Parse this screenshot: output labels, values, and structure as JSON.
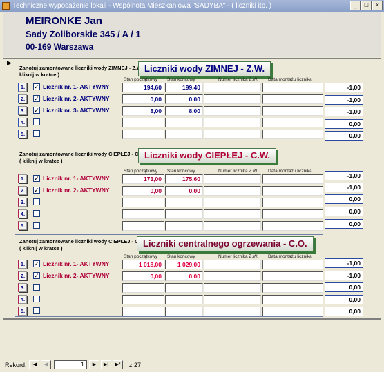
{
  "window": {
    "title": "Techniczne wyposażenie lokali - Wspólnota Mieszkaniowa \"SADYBA\" -  ( liczniki itp. )",
    "buttons": [
      "_",
      "□",
      "×"
    ]
  },
  "owner": {
    "name": "MEIRONKE Jan",
    "address": "Sady Żoliborskie 345 /  A /  1",
    "city": "00-169 Warszawa"
  },
  "record_marker": "▶",
  "columns": {
    "start": "Stan początkowy",
    "end": "Stan końcowy",
    "meter": "Numer licznika Z.W.",
    "date": "Data montażu licznika"
  },
  "sections": [
    {
      "label": "Zanotuj zamontowane liczniki wody ZIMNEJ - Z.W. -( kliknij w kratce )",
      "banner": "Liczniki wody ZIMNEJ  - Z.W.",
      "banner_color": "#000080",
      "rows": [
        {
          "num": "1.",
          "checked": true,
          "label": "Licznik nr. 1- AKTYWNY",
          "start": "194,60",
          "end": "199,40",
          "side": "-1,00"
        },
        {
          "num": "2.",
          "checked": true,
          "label": "Licznik nr. 2- AKTYWNY",
          "start": "0,00",
          "end": "0,00",
          "side": "-1,00"
        },
        {
          "num": "3.",
          "checked": true,
          "label": "Licznik nr. 3- AKTYWNY",
          "start": "8,00",
          "end": "8,00",
          "side": "-1,00"
        },
        {
          "num": "4.",
          "checked": false,
          "label": "",
          "start": "",
          "end": "",
          "side": "0,00"
        },
        {
          "num": "5.",
          "checked": false,
          "label": "",
          "start": "",
          "end": "",
          "side": "0,00"
        }
      ]
    },
    {
      "label": "Zanotuj zamontowane liczniki wody CIEPŁEJ - C.W. -( kliknij w kratce )",
      "banner": "Liczniki wody CIEPŁEJ  - C.W.",
      "banner_color": "#b0003a",
      "rows": [
        {
          "num": "1.",
          "checked": true,
          "label": "Licznik nr. 1- AKTYWNY",
          "start": "173,00",
          "end": "175,60",
          "side": "-1,00"
        },
        {
          "num": "2.",
          "checked": true,
          "label": "Licznik nr. 2- AKTYWNY",
          "start": "0,00",
          "end": "0,00",
          "side": "-1,00"
        },
        {
          "num": "3.",
          "checked": false,
          "label": "",
          "start": "",
          "end": "",
          "side": "0,00"
        },
        {
          "num": "4.",
          "checked": false,
          "label": "",
          "start": "",
          "end": "",
          "side": "0,00"
        },
        {
          "num": "5.",
          "checked": false,
          "label": "",
          "start": "",
          "end": "",
          "side": "0,00"
        }
      ]
    },
    {
      "label": "Zanotuj zamontowane liczniki wody CIEPŁEJ - C.W. -( kliknij w kratce )",
      "banner": "Liczniki centralnego ogrzewania - C.O.",
      "banner_color": "#7a0030",
      "rows": [
        {
          "num": "1.",
          "checked": true,
          "label": "Licznik nr. 1- AKTYWNY",
          "start": "1 018,00",
          "end": "1 029,00",
          "side": "-1,00"
        },
        {
          "num": "2.",
          "checked": true,
          "label": "Licznik nr. 2- AKTYWNY",
          "start": "0,00",
          "end": "0,00",
          "side": "-1,00"
        },
        {
          "num": "3.",
          "checked": false,
          "label": "",
          "start": "",
          "end": "",
          "side": "0,00"
        },
        {
          "num": "4.",
          "checked": false,
          "label": "",
          "start": "",
          "end": "",
          "side": "0,00"
        },
        {
          "num": "5.",
          "checked": false,
          "label": "",
          "start": "",
          "end": "",
          "side": "0,00"
        }
      ]
    }
  ],
  "navigation": {
    "label": "Rekord:",
    "current": "1",
    "total": "z 27",
    "buttons": [
      "|◀",
      "◀",
      "▶",
      "▶|",
      "▶*"
    ]
  },
  "colors": {
    "zimnej_text": "#000080",
    "ciepla_text": "#b0003a",
    "co_text": "#b0003a",
    "co_text_light": "#e00040"
  }
}
